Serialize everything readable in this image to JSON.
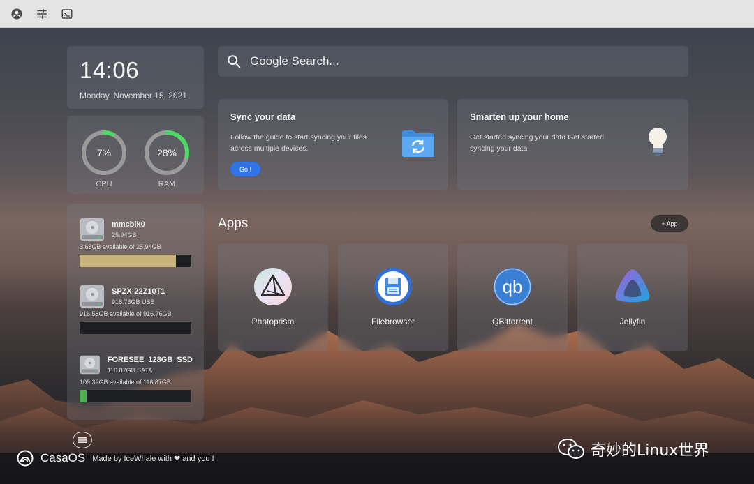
{
  "topbar": {
    "icons": [
      "account-icon",
      "settings-sliders-icon",
      "terminal-icon"
    ]
  },
  "clock": {
    "time": "14:06",
    "date": "Monday, November 15, 2021"
  },
  "system": {
    "cpu": {
      "percent_label": "7%",
      "label": "CPU",
      "value": 0.07
    },
    "ram": {
      "percent_label": "28%",
      "label": "RAM",
      "value": 0.28
    }
  },
  "disks": [
    {
      "name": "mmcblk0",
      "size": "25.94GB",
      "available": "3.68GB available of 25.94GB",
      "used_fraction": 0.86,
      "color": "#c7b27a"
    },
    {
      "name": "SPZX-22Z10T1",
      "size": "916.76GB USB",
      "available": "916.58GB available of 916.76GB",
      "used_fraction": 0.0,
      "color": "#4caf50"
    },
    {
      "name": "FORESEE_128GB_SSD",
      "size": "116.87GB SATA",
      "available": "109.39GB available of 116.87GB",
      "used_fraction": 0.064,
      "color": "#4caf50"
    }
  ],
  "search": {
    "placeholder": "Google Search..."
  },
  "promos": {
    "sync": {
      "title": "Sync your data",
      "description": "Follow the guide to start syncing your files across multiple devices.",
      "button": "Go !"
    },
    "home": {
      "title": "Smarten up your home",
      "description": "Get started syncing your data.Get started syncing your data."
    }
  },
  "apps": {
    "title": "Apps",
    "add_label": "+ App",
    "items": [
      {
        "label": "Photoprism",
        "icon": "photoprism-icon"
      },
      {
        "label": "Filebrowser",
        "icon": "filebrowser-icon"
      },
      {
        "label": "QBittorrent",
        "icon": "qbittorrent-icon",
        "icon_text": "qb"
      },
      {
        "label": "Jellyfin",
        "icon": "jellyfin-icon"
      }
    ]
  },
  "footer": {
    "brand": "CasaOS",
    "made_by": "Made by IceWhale with ❤ and you !"
  },
  "watermark": {
    "text": "奇妙的Linux世界"
  },
  "colors": {
    "accent_blue": "#2f74e8",
    "gauge_green": "#4cd964",
    "gauge_track": "#9a9a9a"
  }
}
